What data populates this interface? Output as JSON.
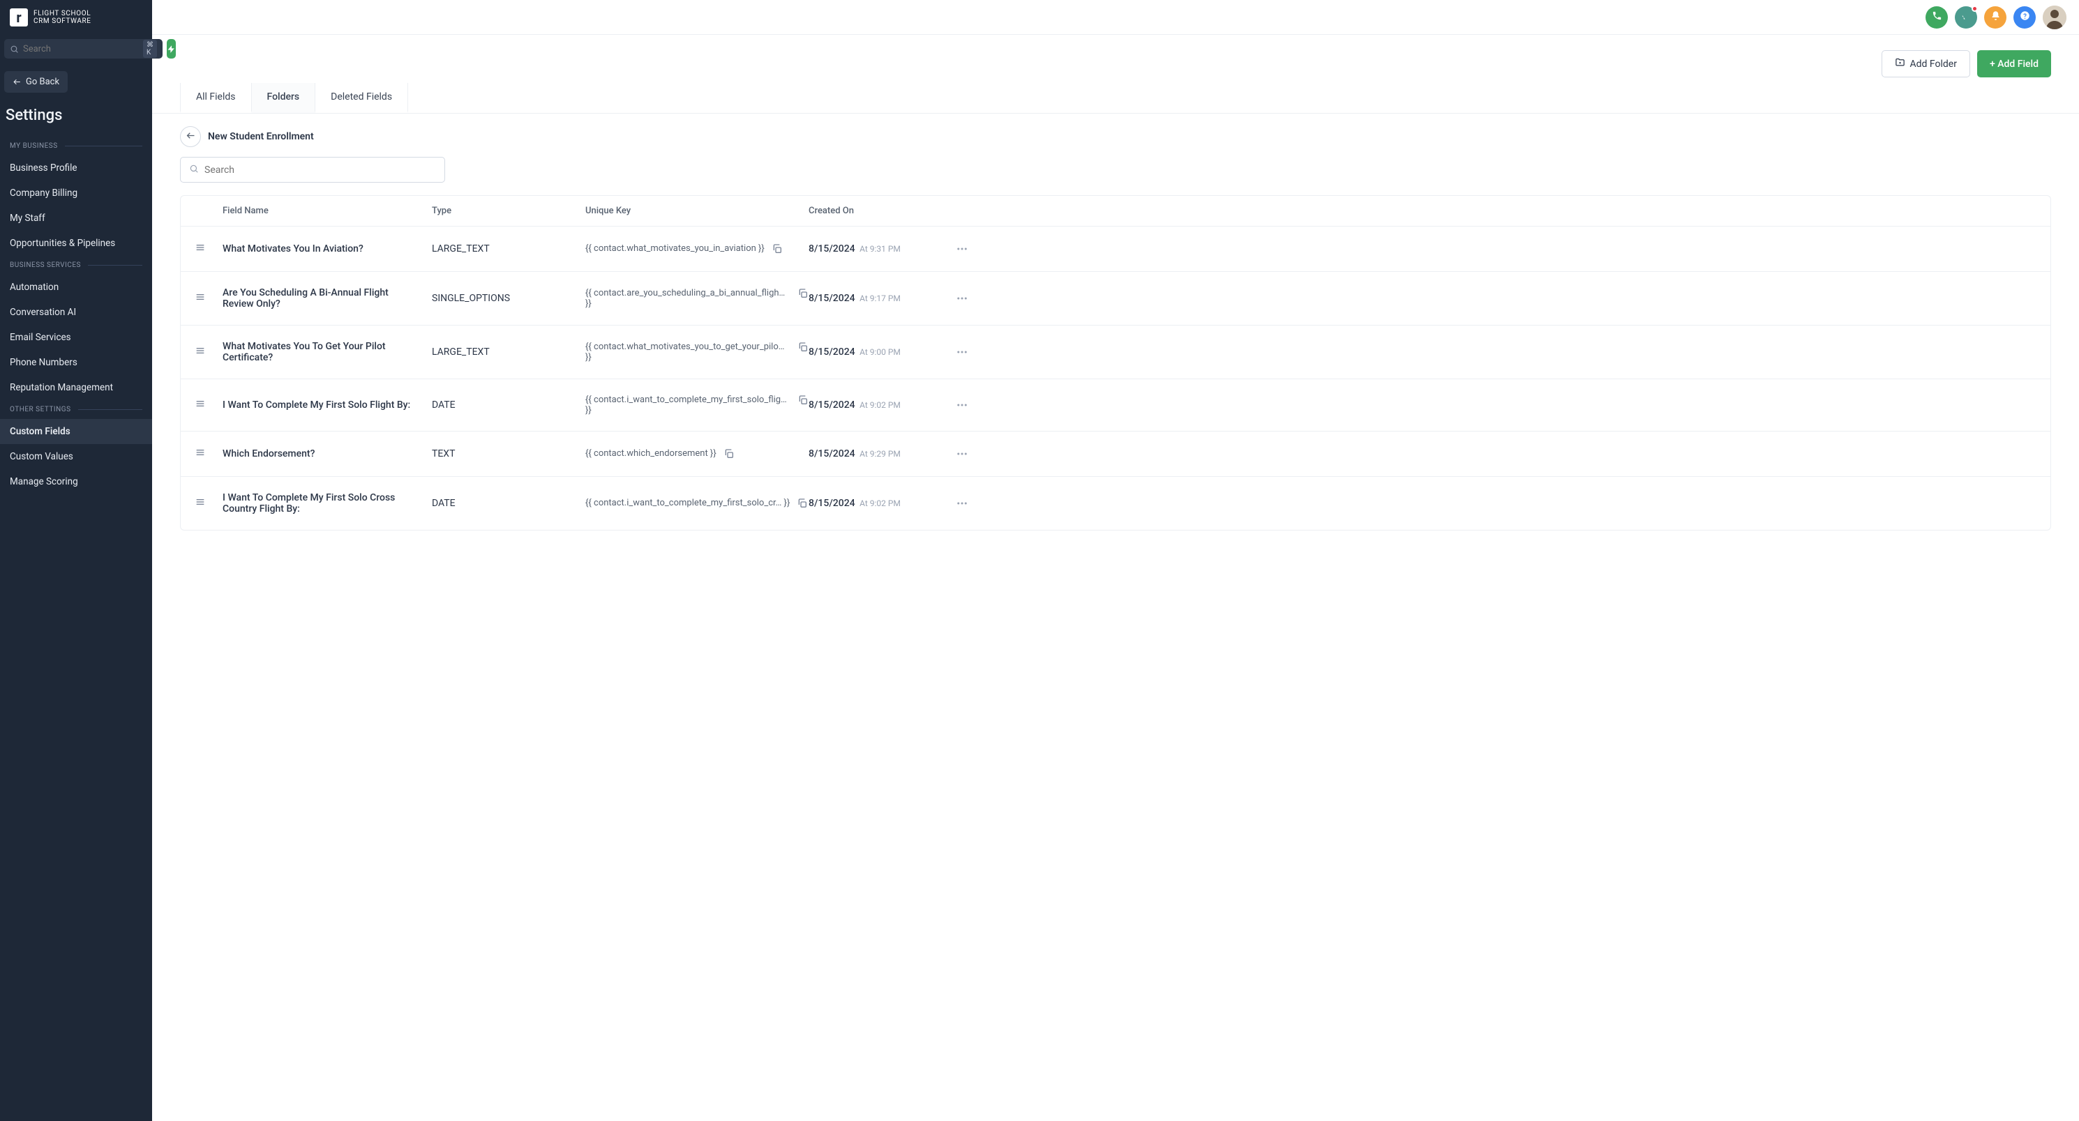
{
  "logo": {
    "line1": "FLIGHT SCHOOL",
    "line2": "CRM SOFTWARE"
  },
  "search": {
    "placeholder": "Search",
    "shortcut": "⌘ K"
  },
  "go_back": "Go Back",
  "settings_title": "Settings",
  "nav": {
    "section1": "My Business",
    "section2": "Business Services",
    "section3": "Other Settings",
    "items": {
      "business_profile": "Business Profile",
      "company_billing": "Company Billing",
      "my_staff": "My Staff",
      "opp_pipelines": "Opportunities & Pipelines",
      "automation": "Automation",
      "conversation_ai": "Conversation AI",
      "email_services": "Email Services",
      "phone_numbers": "Phone Numbers",
      "reputation": "Reputation Management",
      "custom_fields": "Custom Fields",
      "custom_values": "Custom Values",
      "manage_scoring": "Manage Scoring"
    }
  },
  "actions": {
    "add_folder": "Add Folder",
    "add_field": "+ Add Field"
  },
  "tabs": {
    "all": "All Fields",
    "folders": "Folders",
    "deleted": "Deleted Fields"
  },
  "folder_name": "New Student Enrollment",
  "list_search_placeholder": "Search",
  "columns": {
    "name": "Field Name",
    "type": "Type",
    "key": "Unique Key",
    "created": "Created On"
  },
  "rows": [
    {
      "name": "What Motivates You In Aviation?",
      "type": "LARGE_TEXT",
      "key": "{{ contact.what_motivates_you_in_aviation }}",
      "date": "8/15/2024",
      "time": "At 9:31 PM"
    },
    {
      "name": "Are You Scheduling A Bi-Annual Flight Review Only?",
      "type": "SINGLE_OPTIONS",
      "key": "{{ contact.are_you_scheduling_a_bi_annual_fligh… }}",
      "date": "8/15/2024",
      "time": "At 9:17 PM"
    },
    {
      "name": "What Motivates You To Get Your Pilot Certificate?",
      "type": "LARGE_TEXT",
      "key": "{{ contact.what_motivates_you_to_get_your_pilo… }}",
      "date": "8/15/2024",
      "time": "At 9:00 PM"
    },
    {
      "name": "I Want To Complete My First Solo Flight By:",
      "type": "DATE",
      "key": "{{ contact.i_want_to_complete_my_first_solo_flig… }}",
      "date": "8/15/2024",
      "time": "At 9:02 PM"
    },
    {
      "name": "Which Endorsement?",
      "type": "TEXT",
      "key": "{{ contact.which_endorsement }}",
      "date": "8/15/2024",
      "time": "At 9:29 PM"
    },
    {
      "name": "I Want To Complete My First Solo Cross Country Flight By:",
      "type": "DATE",
      "key": "{{ contact.i_want_to_complete_my_first_solo_cr… }}",
      "date": "8/15/2024",
      "time": "At 9:02 PM"
    }
  ]
}
